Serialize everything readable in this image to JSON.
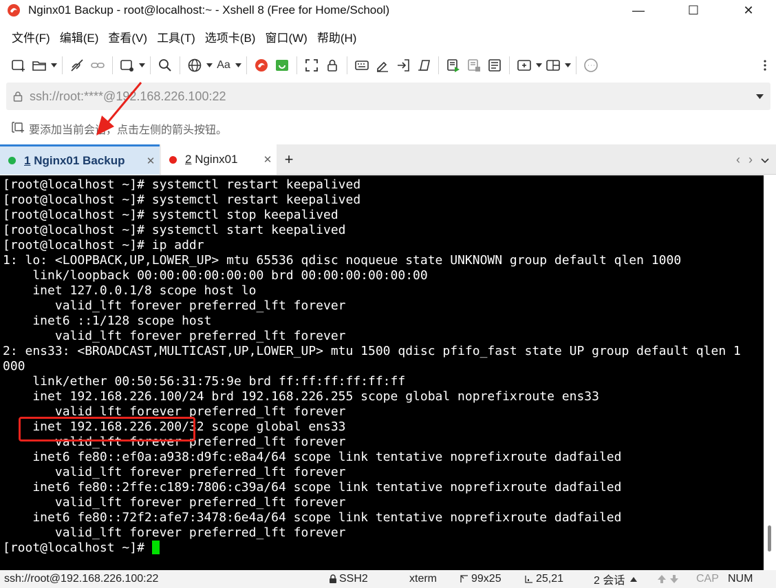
{
  "window": {
    "title": "Nginx01 Backup - root@localhost:~ - Xshell 8 (Free for Home/School)",
    "minimize_glyph": "—",
    "maximize_glyph": "☐",
    "close_glyph": "✕"
  },
  "menu": [
    "文件(F)",
    "编辑(E)",
    "查看(V)",
    "工具(T)",
    "选项卡(B)",
    "窗口(W)",
    "帮助(H)"
  ],
  "toolbar": {
    "font_label": "Aa",
    "icons": [
      "new-session-icon",
      "open-folder-icon",
      "disconnect-icon",
      "link-icon",
      "new-window-icon",
      "search-icon",
      "globe-icon",
      "font-icon",
      "xshell-logo-icon",
      "xftp-icon",
      "fullscreen-icon",
      "lock-icon",
      "keyboard-icon",
      "highlight-icon",
      "login-script-icon",
      "compose-icon",
      "script-run-icon",
      "script-stop-icon",
      "log-icon",
      "add-tab-icon",
      "layout-icon",
      "chat-icon",
      "more-icon"
    ]
  },
  "address": {
    "value": "ssh://root:****@192.168.226.100:22"
  },
  "hint": {
    "text": "要添加当前会话，点击左侧的箭头按钮。"
  },
  "tabs": [
    {
      "number": "1",
      "label": "Nginx01 Backup",
      "status_color": "#22b14c",
      "active": true
    },
    {
      "number": "2",
      "label": "Nginx01",
      "status_color": "#e8231c",
      "active": false
    }
  ],
  "tab_controls": {
    "add": "+",
    "prev": "‹",
    "next": "›",
    "menu": "⌄"
  },
  "terminal": {
    "lines": [
      "[root@localhost ~]# systemctl restart keepalived",
      "[root@localhost ~]# systemctl restart keepalived",
      "[root@localhost ~]# systemctl stop keepalived",
      "[root@localhost ~]# systemctl start keepalived",
      "[root@localhost ~]# ip addr",
      "1: lo: <LOOPBACK,UP,LOWER_UP> mtu 65536 qdisc noqueue state UNKNOWN group default qlen 1000",
      "    link/loopback 00:00:00:00:00:00 brd 00:00:00:00:00:00",
      "    inet 127.0.0.1/8 scope host lo",
      "       valid_lft forever preferred_lft forever",
      "    inet6 ::1/128 scope host",
      "       valid_lft forever preferred_lft forever",
      "2: ens33: <BROADCAST,MULTICAST,UP,LOWER_UP> mtu 1500 qdisc pfifo_fast state UP group default qlen 1",
      "000",
      "    link/ether 00:50:56:31:75:9e brd ff:ff:ff:ff:ff:ff",
      "    inet 192.168.226.100/24 brd 192.168.226.255 scope global noprefixroute ens33",
      "       valid_lft forever preferred_lft forever",
      "    inet 192.168.226.200/32 scope global ens33",
      "       valid_lft forever preferred_lft forever",
      "    inet6 fe80::ef0a:a938:d9fc:e8a4/64 scope link tentative noprefixroute dadfailed",
      "       valid_lft forever preferred_lft forever",
      "    inet6 fe80::2ffe:c189:7806:c39a/64 scope link tentative noprefixroute dadfailed",
      "       valid_lft forever preferred_lft forever",
      "    inet6 fe80::72f2:afe7:3478:6e4a/64 scope link tentative noprefixroute dadfailed",
      "       valid_lft forever preferred_lft forever"
    ],
    "prompt": "[root@localhost ~]# "
  },
  "status": {
    "connection": "ssh://root@192.168.226.100:22",
    "protocol": "SSH2",
    "term_type": "xterm",
    "size": "99x25",
    "cursor_pos": "25,21",
    "sessions": "2 会话",
    "cap": "CAP",
    "num": "NUM"
  },
  "colors": {
    "tab_active_bg": "#d7e6f5",
    "tab_active_border": "#2f7fd6",
    "annotation_red": "#e8231c",
    "cursor_green": "#00e000"
  }
}
